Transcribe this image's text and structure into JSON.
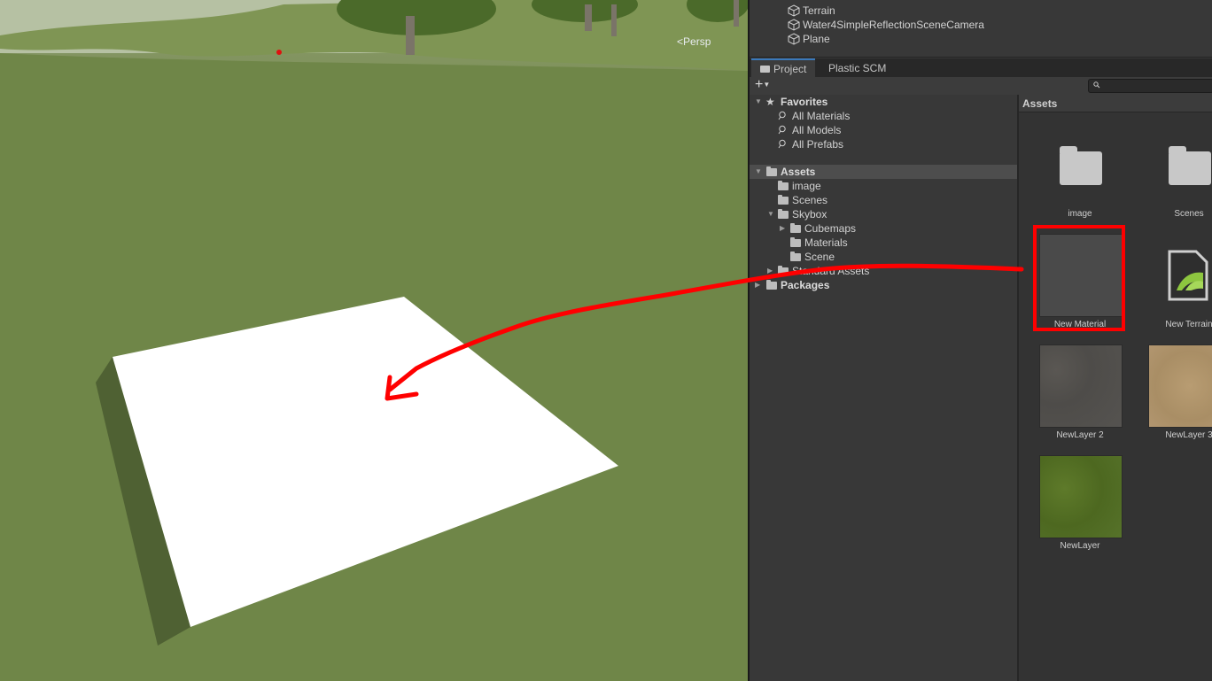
{
  "scene_view": {
    "projection_label": "Persp"
  },
  "hierarchy": {
    "items": [
      "Terrain",
      "Water4SimpleReflectionSceneCamera",
      "Plane"
    ]
  },
  "project_window": {
    "tabs": [
      "Project",
      "Plastic SCM"
    ],
    "add_label": "+",
    "search_placeholder": ""
  },
  "tree": {
    "favorites_label": "Favorites",
    "favorites": [
      "All Materials",
      "All Models",
      "All Prefabs"
    ],
    "assets_label": "Assets",
    "assets_children": [
      "image",
      "Scenes",
      "Skybox"
    ],
    "skybox_children": [
      "Cubemaps",
      "Materials",
      "Scene"
    ],
    "standard_assets": "Standard Assets",
    "packages_label": "Packages"
  },
  "assets_panel": {
    "header": "Assets",
    "items": [
      "image",
      "Scenes",
      "New Material",
      "New Terrain",
      "NewLayer 2",
      "NewLayer 3",
      "NewLayer"
    ]
  },
  "colors": {
    "annotation": "#ff0000",
    "selection_tab": "#3a79bb"
  }
}
